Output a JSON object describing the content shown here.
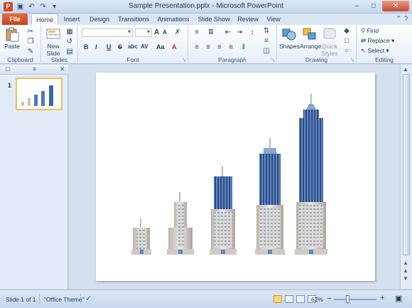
{
  "window": {
    "title": "Sample Presentation.pptx - Microsoft PowerPoint",
    "app_icon_letter": "P",
    "controls": [
      "minimize",
      "maximize",
      "close"
    ]
  },
  "quick_access": [
    "save-icon",
    "undo-icon",
    "redo-icon",
    "customize-icon"
  ],
  "tabs": [
    {
      "label": "File"
    },
    {
      "label": "Home"
    },
    {
      "label": "Insert"
    },
    {
      "label": "Design"
    },
    {
      "label": "Transitions"
    },
    {
      "label": "Animations"
    },
    {
      "label": "Slide Show"
    },
    {
      "label": "Review"
    },
    {
      "label": "View"
    }
  ],
  "active_tab": "Home",
  "ribbon": {
    "clipboard": {
      "label": "Clipboard",
      "paste": "Paste"
    },
    "slides": {
      "label": "Slides",
      "new_slide_line1": "New",
      "new_slide_line2": "Slide"
    },
    "font": {
      "label": "Font",
      "bold": "B",
      "italic": "I",
      "underline": "U",
      "strike": "S",
      "shadow": "abc",
      "spacing": "AV",
      "case": "Aa",
      "color": "A",
      "grow": "A",
      "shrink": "A"
    },
    "paragraph": {
      "label": "Paragraph"
    },
    "drawing": {
      "label": "Drawing",
      "shapes": "Shapes",
      "arrange": "Arrange",
      "quick_styles_line1": "Quick",
      "quick_styles_line2": "Styles"
    },
    "editing": {
      "label": "Editing",
      "find": "Find",
      "replace": "Replace",
      "select": "Select"
    }
  },
  "slide_panel": {
    "thumbnail_number": "1"
  },
  "status": {
    "slide_info": "Slide 1 of 1",
    "theme": "\"Office Theme\"",
    "zoom": "62%",
    "zoom_minus": "−",
    "zoom_plus": "+"
  },
  "slide_content": {
    "buildings": [
      {
        "label": "building-1",
        "height_rel": 0.27
      },
      {
        "label": "building-2",
        "height_rel": 0.43
      },
      {
        "label": "building-3",
        "height_rel": 0.61
      },
      {
        "label": "building-4",
        "height_rel": 0.77
      },
      {
        "label": "building-5",
        "height_rel": 1.0
      }
    ]
  }
}
